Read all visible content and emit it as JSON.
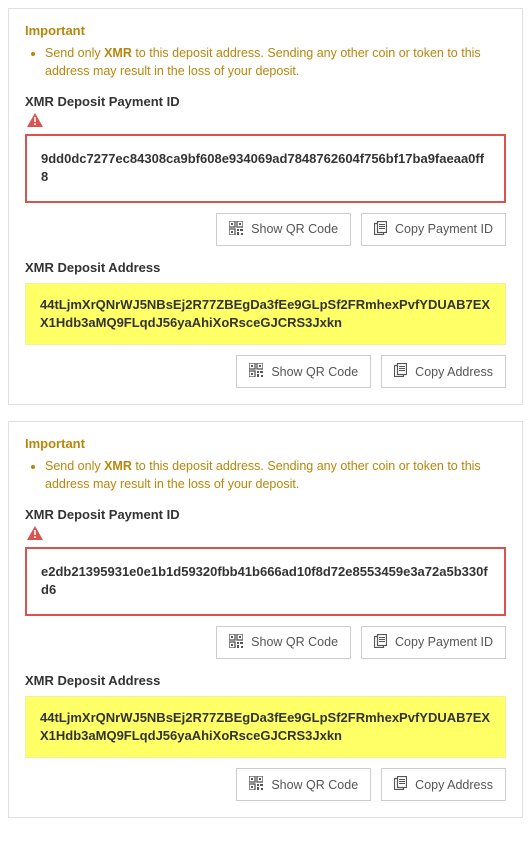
{
  "panels": [
    {
      "important_title": "Important",
      "warning_prefix": "Send only ",
      "warning_coin": "XMR",
      "warning_suffix": " to this deposit address. Sending any other coin or token to this address may result in the loss of your deposit.",
      "payment_id_label": "XMR Deposit Payment ID",
      "payment_id_value": "9dd0dc7277ec84308ca9bf608e934069ad7848762604f756bf17ba9faeaa0ff8",
      "show_qr_label": "Show QR Code",
      "copy_payment_label": "Copy Payment ID",
      "address_label": "XMR Deposit Address",
      "address_value": "44tLjmXrQNrWJ5NBsEj2R77ZBEgDa3fEe9GLpSf2FRmhexPvfYDUAB7EXX1Hdb3aMQ9FLqdJ56yaAhiXoRsceGJCRS3Jxkn",
      "copy_address_label": "Copy Address"
    },
    {
      "important_title": "Important",
      "warning_prefix": "Send only ",
      "warning_coin": "XMR",
      "warning_suffix": " to this deposit address. Sending any other coin or token to this address may result in the loss of your deposit.",
      "payment_id_label": "XMR Deposit Payment ID",
      "payment_id_value": "e2db21395931e0e1b1d59320fbb41b666ad10f8d72e8553459e3a72a5b330fd6",
      "show_qr_label": "Show QR Code",
      "copy_payment_label": "Copy Payment ID",
      "address_label": "XMR Deposit Address",
      "address_value": "44tLjmXrQNrWJ5NBsEj2R77ZBEgDa3fEe9GLpSf2FRmhexPvfYDUAB7EXX1Hdb3aMQ9FLqdJ56yaAhiXoRsceGJCRS3Jxkn",
      "copy_address_label": "Copy Address"
    }
  ]
}
